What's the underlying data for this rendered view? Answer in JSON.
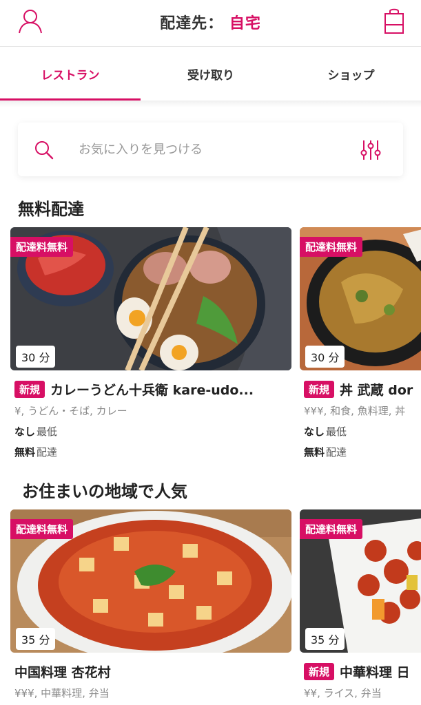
{
  "header": {
    "delivery_label": "配達先：",
    "delivery_value": "自宅",
    "profile_icon": "user-icon",
    "cart_icon": "shopping-bag-icon"
  },
  "tabs": [
    {
      "label": "レストラン",
      "active": true
    },
    {
      "label": "受け取り",
      "active": false
    },
    {
      "label": "ショップ",
      "active": false
    }
  ],
  "search": {
    "placeholder": "お気に入りを見つける",
    "search_icon": "search-icon",
    "filter_icon": "filter-sliders-icon"
  },
  "sections": [
    {
      "title": "無料配達",
      "cards": [
        {
          "badge": "配達料無料",
          "time": "30 分",
          "new_tag": "新規",
          "name": "カレーうどん十兵衛 kare-udo...",
          "cuisine": "¥, うどん・そば, カレー",
          "min_value": "なし",
          "min_label": "最低",
          "delivery_value": "無料",
          "delivery_label": "配達"
        },
        {
          "badge": "配達料無料",
          "time": "30 分",
          "new_tag": "新規",
          "name": "丼 武蔵 dor",
          "cuisine": "¥¥¥, 和食, 魚料理, 丼",
          "min_value": "なし",
          "min_label": "最低",
          "delivery_value": "無料",
          "delivery_label": "配達"
        }
      ]
    },
    {
      "title": "お住まいの地域で人気",
      "cards": [
        {
          "badge": "配達料無料",
          "time": "35 分",
          "new_tag": "",
          "name": "中国料理 杏花村",
          "cuisine": "¥¥¥, 中華料理, 弁当"
        },
        {
          "badge": "配達料無料",
          "time": "35 分",
          "new_tag": "新規",
          "name": "中華料理 日",
          "cuisine": "¥¥, ライス, 弁当"
        }
      ]
    }
  ],
  "colors": {
    "brand": "#d70f64"
  }
}
